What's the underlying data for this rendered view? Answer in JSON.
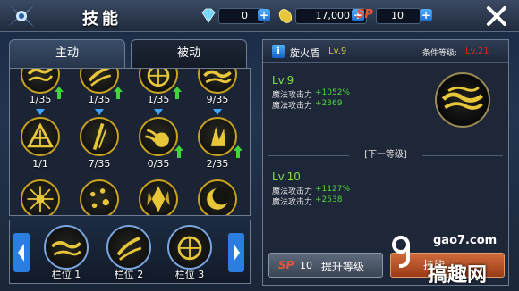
{
  "header": {
    "title": "技能",
    "gems": "0",
    "coins": "17,000",
    "sp_label": "SP",
    "sp": "10",
    "plus": "+"
  },
  "tabs": {
    "active": "主动",
    "passive": "被动"
  },
  "skills": [
    {
      "level": "1/35",
      "upgradable": true,
      "icon": "fire-swirl-skill-icon"
    },
    {
      "level": "1/35",
      "upgradable": true,
      "icon": "claw-slash-skill-icon"
    },
    {
      "level": "1/35",
      "upgradable": true,
      "icon": "flame-wheel-skill-icon"
    },
    {
      "level": "9/35",
      "upgradable": false,
      "icon": "fire-wave-skill-icon"
    },
    {
      "level": "1/1",
      "upgradable": false,
      "icon": "tent-sigil-skill-icon"
    },
    {
      "level": "7/35",
      "upgradable": false,
      "icon": "blade-strike-skill-icon"
    },
    {
      "level": "0/35",
      "upgradable": true,
      "icon": "fireball-skill-icon"
    },
    {
      "level": "2/35",
      "upgradable": true,
      "icon": "flame-burst-skill-icon"
    },
    {
      "icon": "sun-burst-skill-icon"
    },
    {
      "icon": "scatter-shot-skill-icon"
    },
    {
      "icon": "crystal-shard-skill-icon"
    },
    {
      "icon": "crescent-moon-skill-icon"
    }
  ],
  "slots": [
    {
      "label": "栏位 1",
      "icon": "fire-wave-skill-icon"
    },
    {
      "label": "栏位 2",
      "icon": "claw-slash-skill-icon"
    },
    {
      "label": "栏位 3",
      "icon": "flame-wheel-skill-icon"
    }
  ],
  "detail": {
    "info": "i",
    "name": "旋火盾",
    "level": "Lv.9",
    "condition_label": "条件等级:",
    "condition_value": "Lv.21",
    "current": {
      "title": "Lv.9",
      "stats": [
        {
          "name": "魔法攻击力",
          "value": "+1052%"
        },
        {
          "name": "魔法攻击力",
          "value": "+2369"
        }
      ]
    },
    "next_label": "[下一等级]",
    "next": {
      "title": "Lv.10",
      "stats": [
        {
          "name": "魔法攻击力",
          "value": "+1127%"
        },
        {
          "name": "魔法攻击力",
          "value": "+2538"
        }
      ]
    },
    "upgrade": {
      "sp_tag": "SP",
      "cost": "10",
      "label": "提升等级"
    },
    "learn_label": "技能"
  },
  "watermark": {
    "url": "gao7.com",
    "name": "搞趣网"
  },
  "colors": {
    "gold": "#e8c63a",
    "green": "#4fd63c",
    "red": "#e0251e",
    "accent_blue": "#2f8fe8"
  }
}
